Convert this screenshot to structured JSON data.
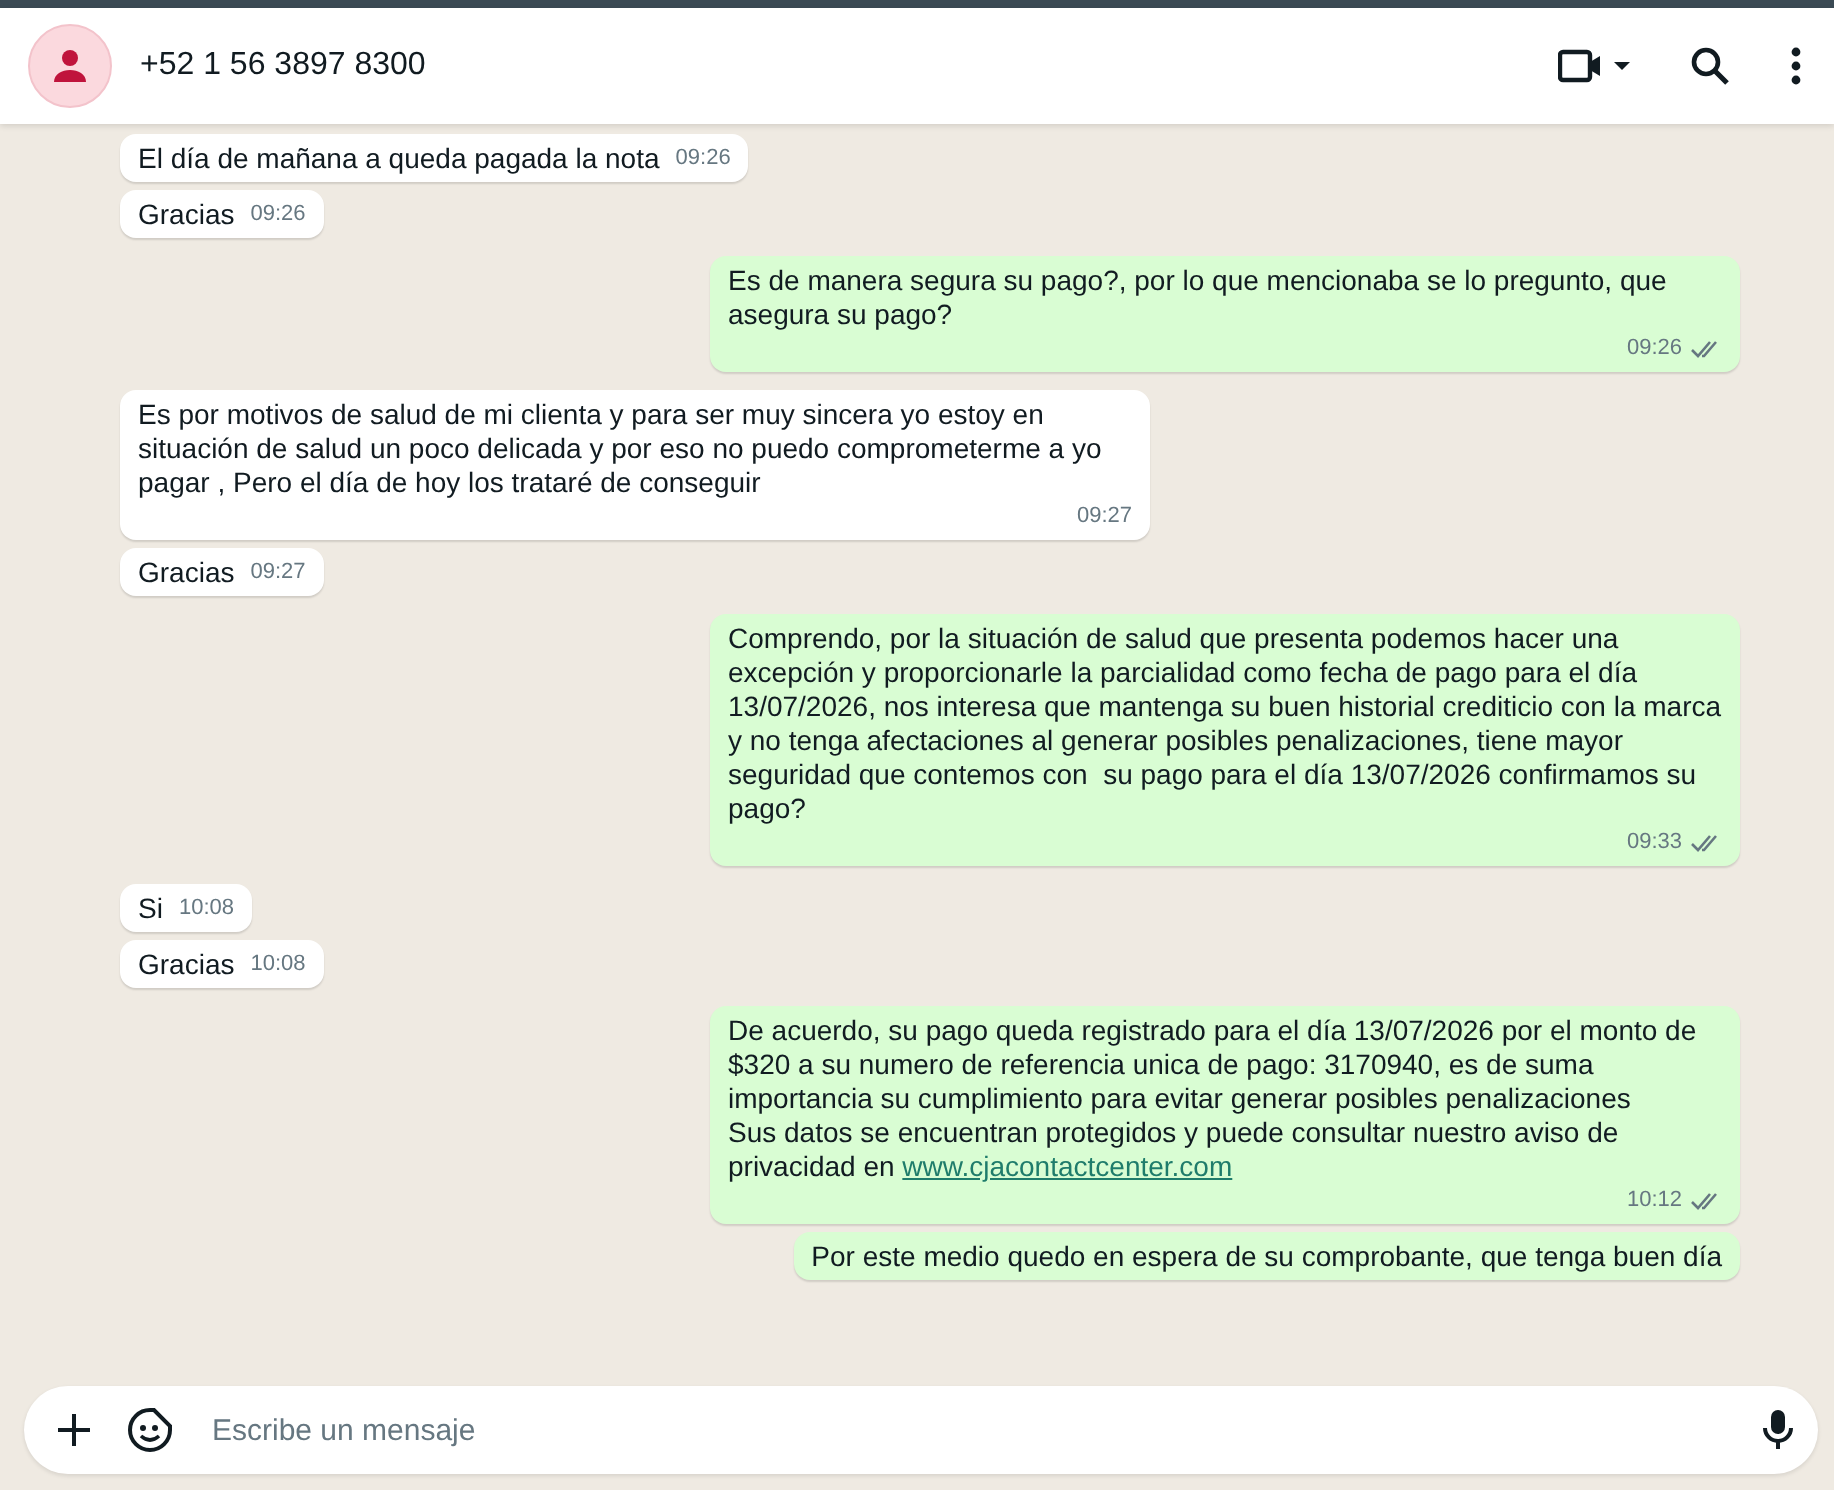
{
  "header": {
    "contact": "+52 1 56 3897 8300"
  },
  "messages": [
    {
      "kind": "incoming",
      "text": "El día de mañana a queda pagada la nota",
      "time": "09:26"
    },
    {
      "kind": "incoming",
      "text": "Gracias",
      "time": "09:26"
    },
    {
      "kind": "outgoing",
      "text": "Es de manera segura su pago?, por lo que mencionaba se lo pregunto, que asegura su pago?",
      "time": "09:26"
    },
    {
      "kind": "incoming",
      "text": "Es por motivos de salud de mi clienta y para ser muy sincera yo estoy en situación de salud un poco delicada y por eso no puedo comprometerme a yo pagar , Pero el día de hoy los trataré de conseguir",
      "time": "09:27"
    },
    {
      "kind": "incoming",
      "text": "Gracias",
      "time": "09:27"
    },
    {
      "kind": "outgoing",
      "text": "Comprendo, por la situación de salud que presenta podemos hacer una excepción y proporcionarle la parcialidad como fecha de pago para el día 13/07/2026, nos interesa que mantenga su buen historial crediticio con la marca y no tenga afectaciones al generar posibles penalizaciones, tiene mayor seguridad que contemos con  su pago para el día 13/07/2026 confirmamos su pago?",
      "time": "09:33"
    },
    {
      "kind": "incoming",
      "text": "Si",
      "time": "10:08"
    },
    {
      "kind": "incoming",
      "text": "Gracias",
      "time": "10:08"
    },
    {
      "kind": "outgoing",
      "text": "De acuerdo, su pago queda registrado para el día 13/07/2026 por el monto de $320 a su numero de referencia unica de pago: 3170940, es de suma importancia su cumplimiento para evitar generar posibles penalizaciones\nSus datos se encuentran protegidos y puede consultar nuestro aviso de privacidad en ",
      "link": "www.cjacontactcenter.com",
      "time": "10:12"
    },
    {
      "kind": "outgoing",
      "text": "Por este medio quedo en espera de su comprobante, que tenga buen día"
    }
  ],
  "composer": {
    "placeholder": "Escribe un mensaje"
  }
}
